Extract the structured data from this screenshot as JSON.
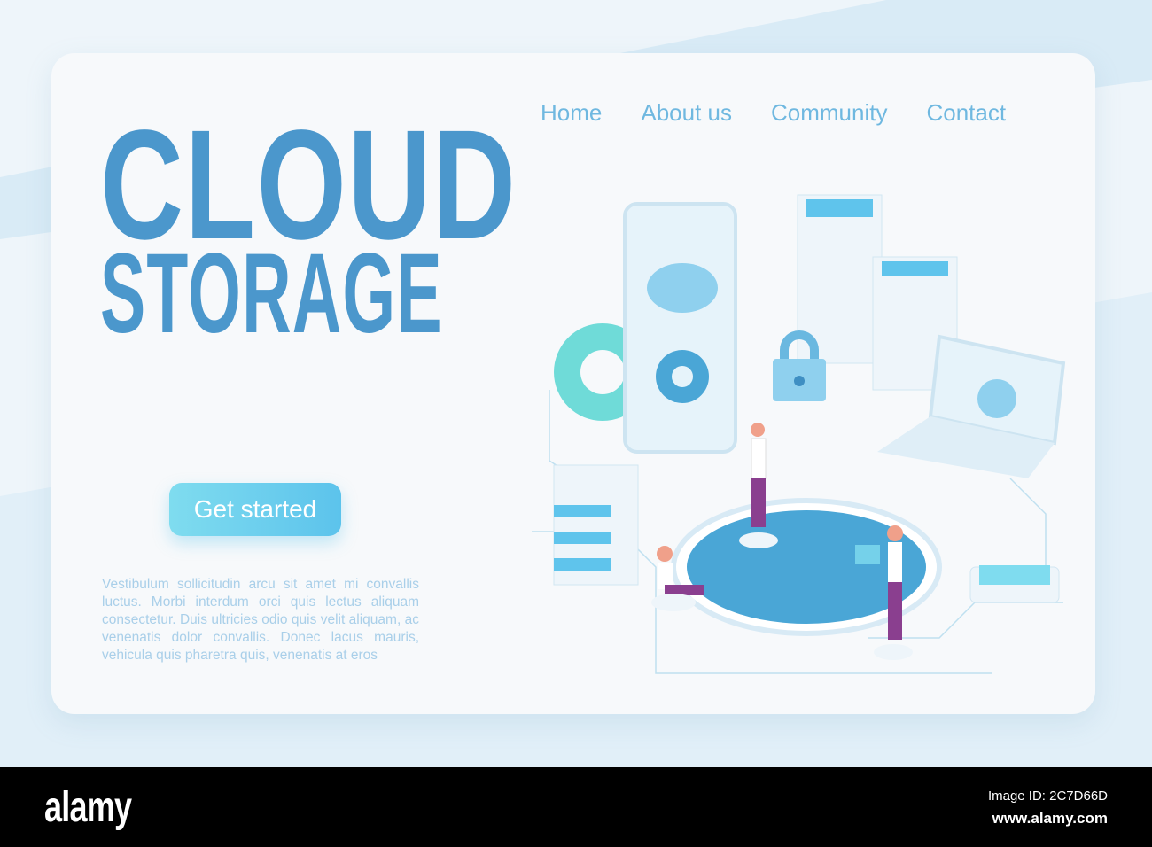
{
  "nav": {
    "items": [
      "Home",
      "About us",
      "Community",
      "Contact"
    ]
  },
  "hero": {
    "title_line1": "CLOUD",
    "title_line2": "STORAGE",
    "cta": "Get started",
    "body": "Vestibulum sollicitudin arcu sit amet mi convallis luctus. Morbi interdum orci quis lectus aliquam consectetur. Duis ultricies odio quis velit aliquam, ac venenatis dolor convallis. Donec lacus mauris, vehicula quis pharetra quis, venenatis at eros"
  },
  "footer": {
    "logo": "alamy",
    "image_id": "Image ID: 2C7D66D",
    "site": "www.alamy.com"
  },
  "colors": {
    "accent": "#4b97cc",
    "nav": "#6fb8e0",
    "button": "#5cc3ec"
  }
}
